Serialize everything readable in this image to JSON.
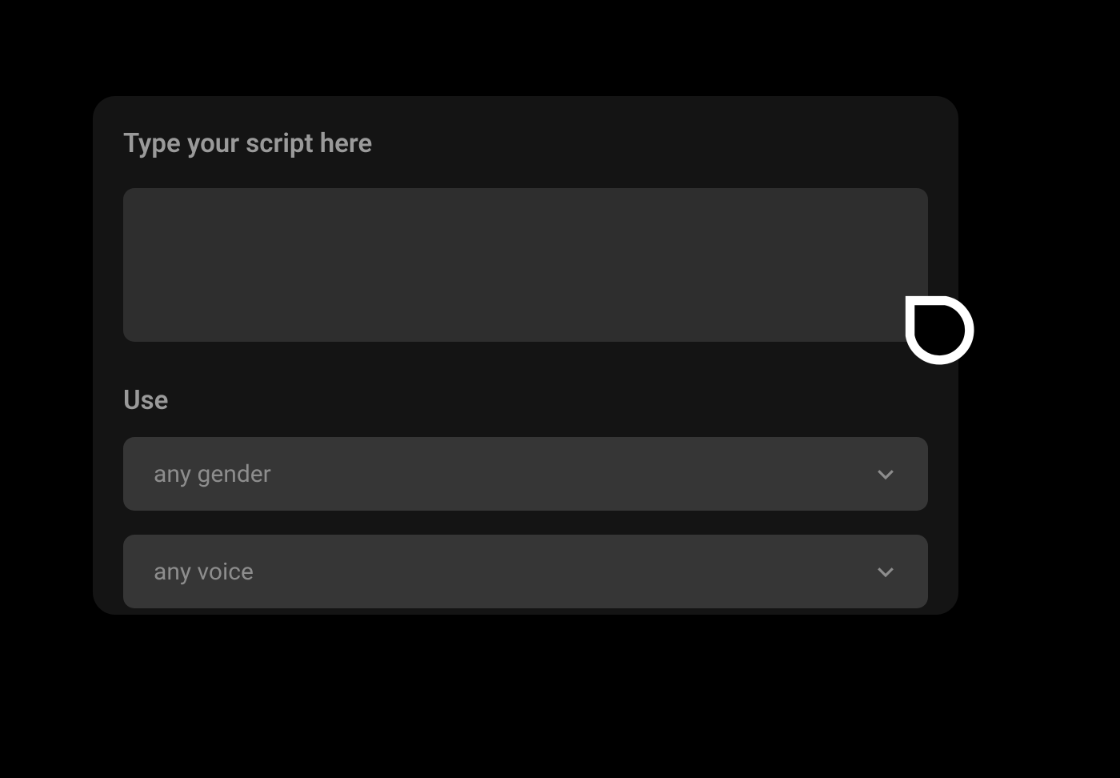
{
  "form": {
    "script_heading": "Type your script here",
    "script_value": "",
    "use_heading": "Use",
    "gender_select": {
      "value": "any gender"
    },
    "voice_select": {
      "value": "any voice"
    }
  }
}
